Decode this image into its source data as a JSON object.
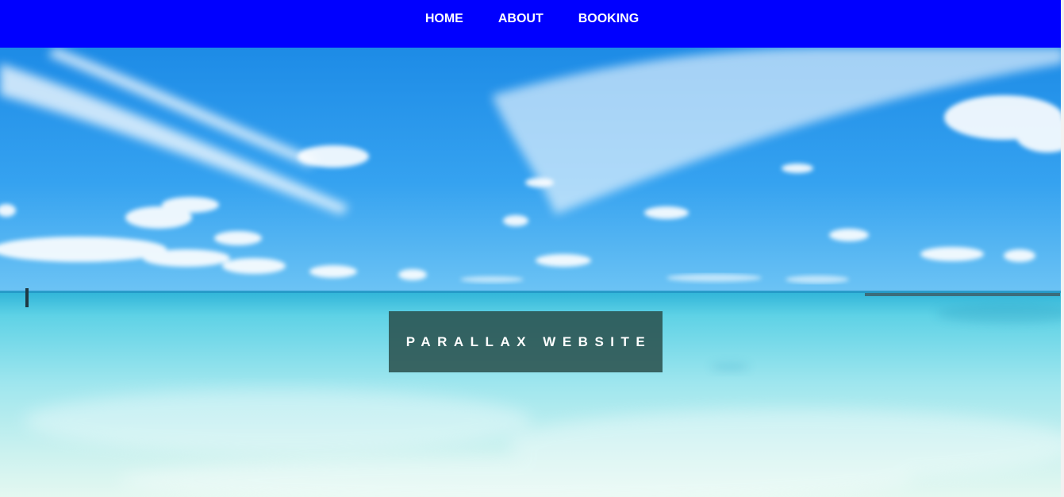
{
  "nav": {
    "items": [
      {
        "label": "HOME"
      },
      {
        "label": "ABOUT"
      },
      {
        "label": "BOOKING"
      }
    ]
  },
  "hero": {
    "title": "PARALLAX WEBSITE"
  },
  "colors": {
    "navbar": "#0000ff",
    "nav_text": "#ffffff",
    "title_box": "#2c5753",
    "sky_top": "#1a8ee8",
    "sea": "#7fdbea"
  }
}
